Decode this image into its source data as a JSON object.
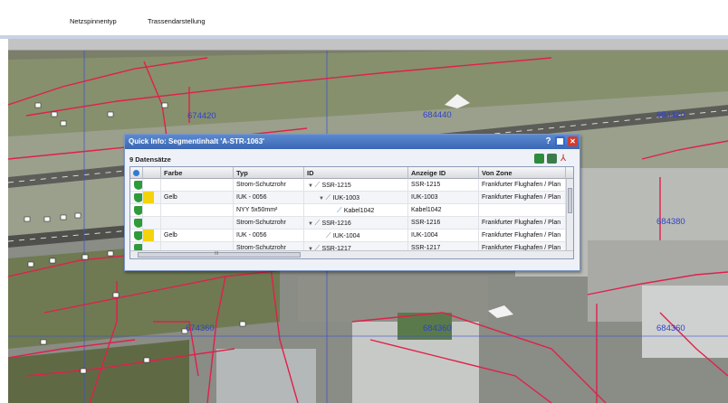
{
  "tabs": [
    {
      "label": "Netzspinnentyp",
      "active": true
    },
    {
      "label": "Trassendarstellung",
      "active": false
    }
  ],
  "map": {
    "grid_labels": [
      "674420",
      "684440",
      "684420",
      "684380",
      "674360",
      "684360",
      "684360"
    ]
  },
  "dialog": {
    "title": "Quick Info: Segmentinhalt 'A-STR-1063'",
    "record_count": "9 Datensätze",
    "columns": [
      "",
      "",
      "Farbe",
      "Typ",
      "ID",
      "Anzeige ID",
      "Von Zone"
    ],
    "rows": [
      {
        "farbe": "",
        "typ": "Strom-Schutzrohr",
        "id": "SSR-1215",
        "anzeige_id": "SSR-1215",
        "von_zone": "Frankfurter Flughafen / Plan",
        "indent": 0,
        "expander": "▼",
        "swatch": false,
        "cable": false
      },
      {
        "farbe": "Gelb",
        "typ": "IUK - 0056",
        "id": "IUK-1003",
        "anzeige_id": "IUK-1003",
        "von_zone": "Frankfurter Flughafen / Plan",
        "indent": 1,
        "expander": "▼",
        "swatch": true,
        "cable": false
      },
      {
        "farbe": "",
        "typ": "NYY 5x50mm²",
        "id": "Kabel1042",
        "anzeige_id": "Kabel1042",
        "von_zone": "",
        "indent": 2,
        "expander": "",
        "swatch": false,
        "cable": true
      },
      {
        "farbe": "",
        "typ": "Strom-Schutzrohr",
        "id": "SSR-1216",
        "anzeige_id": "SSR-1216",
        "von_zone": "Frankfurter Flughafen / Plan",
        "indent": 0,
        "expander": "▼",
        "swatch": false,
        "cable": false
      },
      {
        "farbe": "Gelb",
        "typ": "IUK - 0056",
        "id": "IUK-1004",
        "anzeige_id": "IUK-1004",
        "von_zone": "Frankfurter Flughafen / Plan",
        "indent": 1,
        "expander": "",
        "swatch": true,
        "cable": false
      },
      {
        "farbe": "",
        "typ": "Strom-Schutzrohr",
        "id": "SSR-1217",
        "anzeige_id": "SSR-1217",
        "von_zone": "Frankfurter Flughafen / Plan",
        "indent": 0,
        "expander": "▼",
        "swatch": false,
        "cable": false
      }
    ],
    "scroll_glyph": "III"
  },
  "colors": {
    "title_bar": "#3a66b3",
    "shield": "#2e9a3a",
    "swatch_gelb": "#f5d30a",
    "route_lines": "#e0204a",
    "grid_labels": "#2f43c9"
  },
  "icons": [
    "layers-icon",
    "shield-icon",
    "help-icon",
    "maximize-icon",
    "close-icon",
    "excel-export-icon",
    "pdf-export-icon",
    "cable-icon"
  ]
}
